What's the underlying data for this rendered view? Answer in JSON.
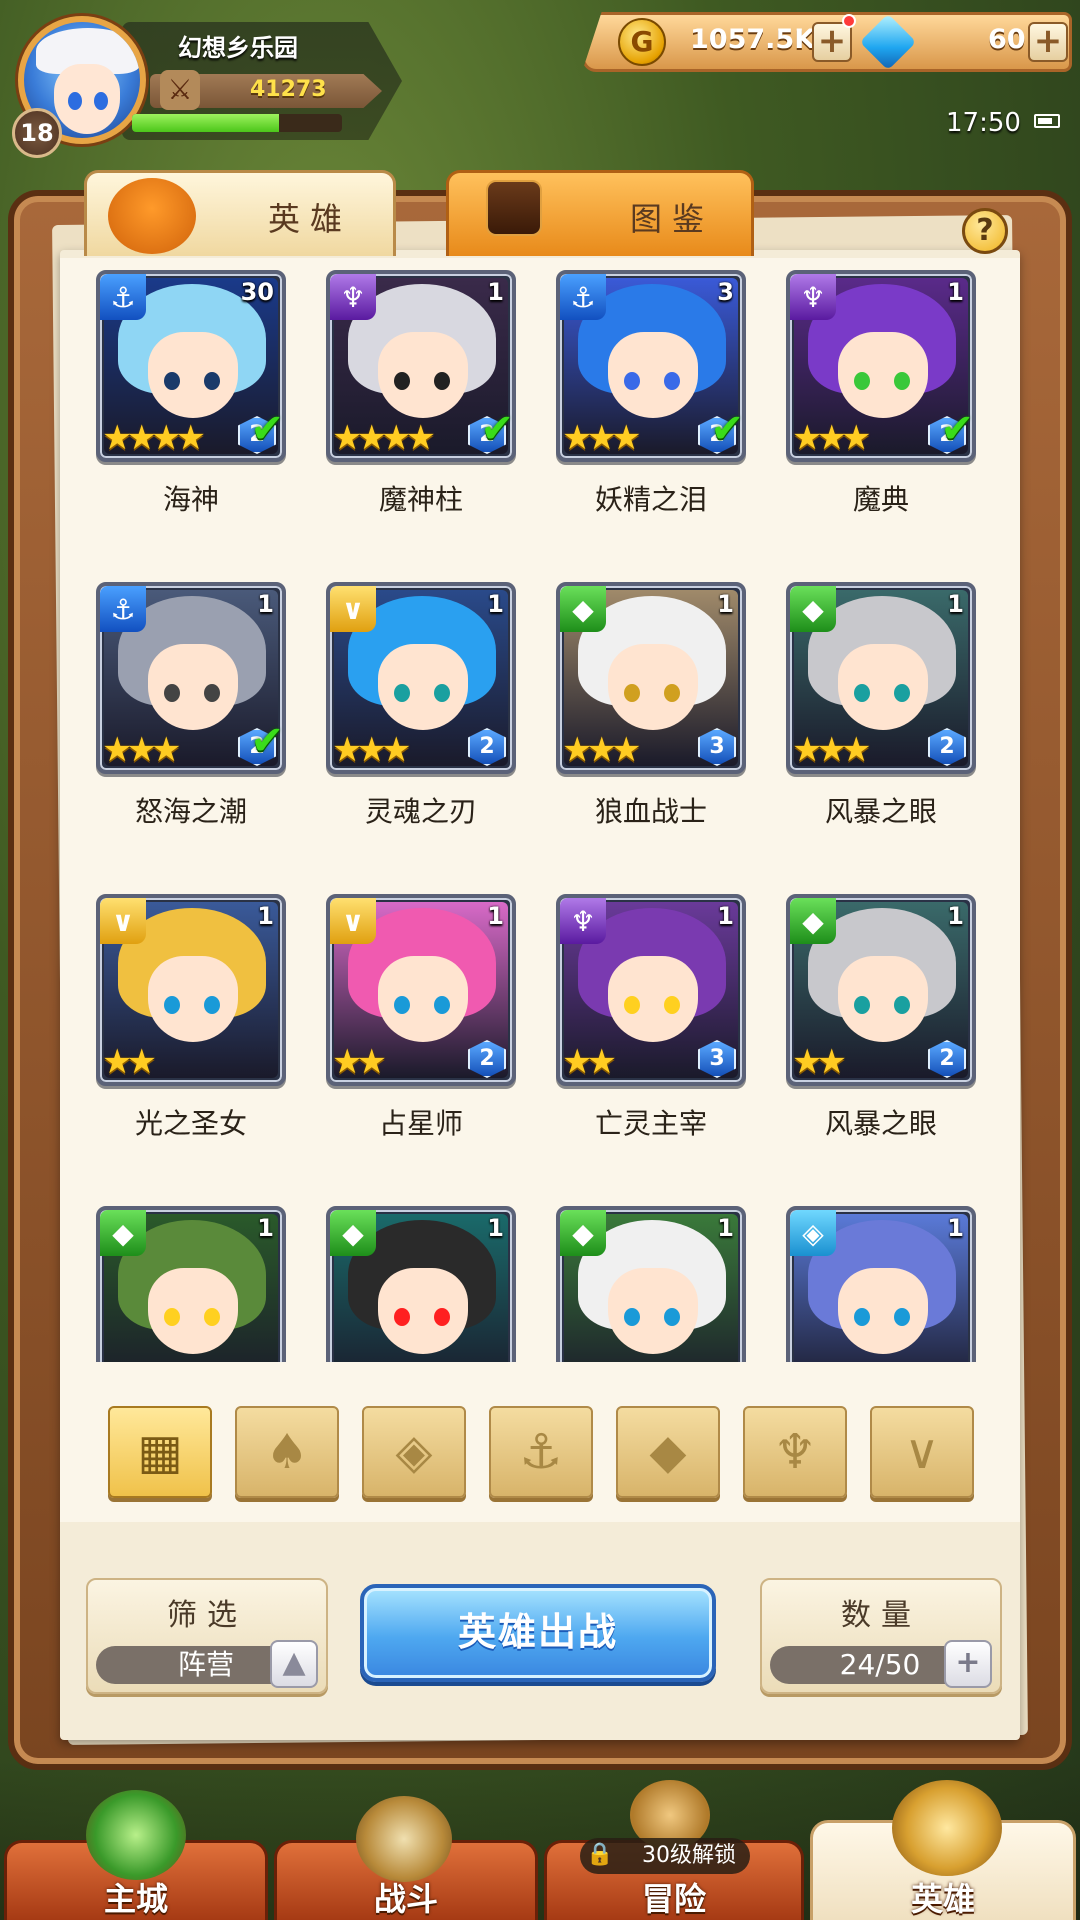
{
  "player": {
    "name": "幻想乡乐园",
    "level": "18",
    "power": "41273",
    "exp_fraction": 0.7
  },
  "currency": {
    "gold": "1057.5K",
    "gems": "60",
    "plus_symbol": "+"
  },
  "status": {
    "time": "17:50"
  },
  "tabs": {
    "heroes": "英雄",
    "codex": "图鉴",
    "help": "?"
  },
  "heroes": [
    {
      "name": "海神",
      "count": "30",
      "faction": "sea",
      "stars": "★★★★",
      "tier": "2",
      "ready": true
    },
    {
      "name": "魔神柱",
      "count": "1",
      "faction": "dark",
      "stars": "★★★★",
      "tier": "2",
      "ready": true
    },
    {
      "name": "妖精之泪",
      "count": "3",
      "faction": "sea",
      "stars": "★★★",
      "tier": "2",
      "ready": true
    },
    {
      "name": "魔典",
      "count": "1",
      "faction": "dark",
      "stars": "★★★",
      "tier": "2",
      "ready": true
    },
    {
      "name": "怒海之潮",
      "count": "1",
      "faction": "sea",
      "stars": "★★★",
      "tier": "2",
      "ready": true
    },
    {
      "name": "灵魂之刃",
      "count": "1",
      "faction": "holy",
      "stars": "★★★",
      "tier": "2",
      "ready": false
    },
    {
      "name": "狼血战士",
      "count": "1",
      "faction": "beast",
      "stars": "★★★",
      "tier": "3",
      "ready": false
    },
    {
      "name": "风暴之眼",
      "count": "1",
      "faction": "beast",
      "stars": "★★★",
      "tier": "2",
      "ready": false
    },
    {
      "name": "光之圣女",
      "count": "1",
      "faction": "holy",
      "stars": "★★",
      "tier": "",
      "ready": false
    },
    {
      "name": "占星师",
      "count": "1",
      "faction": "holy",
      "stars": "★★",
      "tier": "2",
      "ready": false
    },
    {
      "name": "亡灵主宰",
      "count": "1",
      "faction": "dark",
      "stars": "★★",
      "tier": "3",
      "ready": false
    },
    {
      "name": "风暴之眼",
      "count": "1",
      "faction": "beast",
      "stars": "★★",
      "tier": "2",
      "ready": false
    },
    {
      "name": "",
      "count": "1",
      "faction": "beast",
      "stars": "",
      "tier": "",
      "ready": false
    },
    {
      "name": "",
      "count": "1",
      "faction": "beast",
      "stars": "",
      "tier": "",
      "ready": false
    },
    {
      "name": "",
      "count": "1",
      "faction": "beast",
      "stars": "",
      "tier": "",
      "ready": false
    },
    {
      "name": "",
      "count": "1",
      "faction": "water",
      "stars": "",
      "tier": "",
      "ready": false
    }
  ],
  "faction_filters": [
    {
      "icon": "all-grid-icon",
      "glyph": "▦",
      "active": true
    },
    {
      "icon": "forest-faction-icon",
      "glyph": "♠",
      "active": false
    },
    {
      "icon": "water-faction-icon",
      "glyph": "◈",
      "active": false
    },
    {
      "icon": "sea-faction-icon",
      "glyph": "⚓",
      "active": false
    },
    {
      "icon": "beast-faction-icon",
      "glyph": "◆",
      "active": false
    },
    {
      "icon": "dark-faction-icon",
      "glyph": "♆",
      "active": false
    },
    {
      "icon": "holy-faction-icon",
      "glyph": "∨",
      "active": false
    }
  ],
  "controls": {
    "filter_title": "筛选",
    "filter_value": "阵营",
    "deploy_button": "英雄出战",
    "count_title": "数量",
    "count_value": "24/50"
  },
  "nav": {
    "city": "主城",
    "battle": "战斗",
    "adventure": "冒险",
    "adventure_lock": "30级解锁",
    "heroes": "英雄"
  },
  "colors": {
    "accent_gold": "#f0c24a",
    "deploy_blue": "#4ea8f0",
    "nav_orange": "#e0703a",
    "check_green": "#3adc1a"
  }
}
